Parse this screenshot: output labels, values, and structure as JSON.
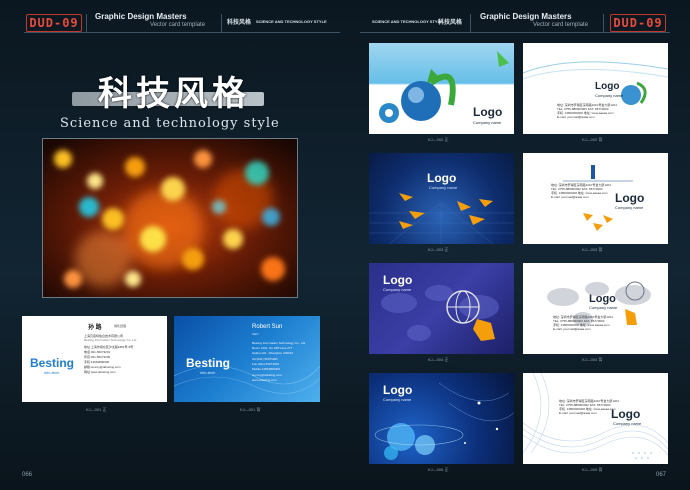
{
  "header": {
    "left_badge": "DUD-09",
    "right_badge": "DUD-09",
    "left_title": "Graphic Design Masters",
    "left_subtitle": "Vector card template",
    "right_title": "Graphic Design Masters",
    "right_subtitle": "Vector card template",
    "left_cn": "科技风格",
    "left_cn_en": "SCIENCE AND TECHNOLOGY STYLE",
    "right_cn_en": "SCIENCE AND TECHNOLOGY STYLE",
    "right_cn": "科技风格"
  },
  "hero": {
    "title_cn": "科技风格",
    "title_en": "Science and technology style"
  },
  "left_cards": {
    "front": {
      "brand": "Besting",
      "brand_sub": "info-tech",
      "name": "孙 路",
      "title": "销售经理",
      "company": "上海贝思特信息技术有限公司",
      "company_en": "Besting Information Technology Co.,Ltd",
      "address": "地址:上海市闸北区沪太路1881号-3号",
      "tel": "电话:021-56073201",
      "fax": "传真:021-56073200",
      "mobile": "手机:13564800000",
      "email": "邮箱:sunroy@ddssting.com",
      "web": "网址:www.ddssting.com",
      "caption": "KJ—001 正"
    },
    "back": {
      "brand": "Besting",
      "brand_sub": "info-tech",
      "name": "Robert Sun",
      "title": "CEO",
      "company": "Besting Information Technology Co., Ltd",
      "address": "Room 1201, No.188 Lane 277",
      "address2": "Haiduo Rd., Shanghai, 200010",
      "tel": "Tel:(021) 56073201",
      "fax": "Fax:(021) 56073200",
      "mobile": "Mobile:13564800000",
      "email": "sunroy@ddssting.com",
      "web": "www.ddssting.com",
      "caption": "KJ—001 背"
    }
  },
  "right_cards": [
    {
      "logo": "Logo",
      "company": "Company name",
      "caption": "KJ—002 正"
    },
    {
      "logo": "Logo",
      "company": "Company name",
      "caption": "KJ—002 背"
    },
    {
      "logo": "Logo",
      "company": "Company name",
      "caption": "KJ—003 正"
    },
    {
      "logo": "Logo",
      "company": "Company name",
      "caption": "KJ—003 背"
    },
    {
      "logo": "Logo",
      "company": "Company name",
      "caption": "KJ—004 正"
    },
    {
      "logo": "Logo",
      "company": "Company name",
      "caption": "KJ—004 背"
    },
    {
      "logo": "Logo",
      "company": "Company name",
      "caption": "KJ—005 正"
    },
    {
      "logo": "Logo",
      "company": "Company name",
      "caption": "KJ—005 背"
    }
  ],
  "card_text": {
    "address": "地址: 深圳市罗湖区深南路1010号金大厦1201",
    "tel": "TEL: 0755-888000000  FAX: 86770000",
    "mobile": "手机: 13800000000  地址: www.aaaaa.com",
    "email": "E-mail: yourmail@aaaa.com"
  },
  "page_numbers": {
    "left": "066",
    "right": "067"
  },
  "colors": {
    "accent_red": "#e74c3c",
    "besting_blue": "#1d7fd0",
    "page_bg": "#0b1720"
  }
}
